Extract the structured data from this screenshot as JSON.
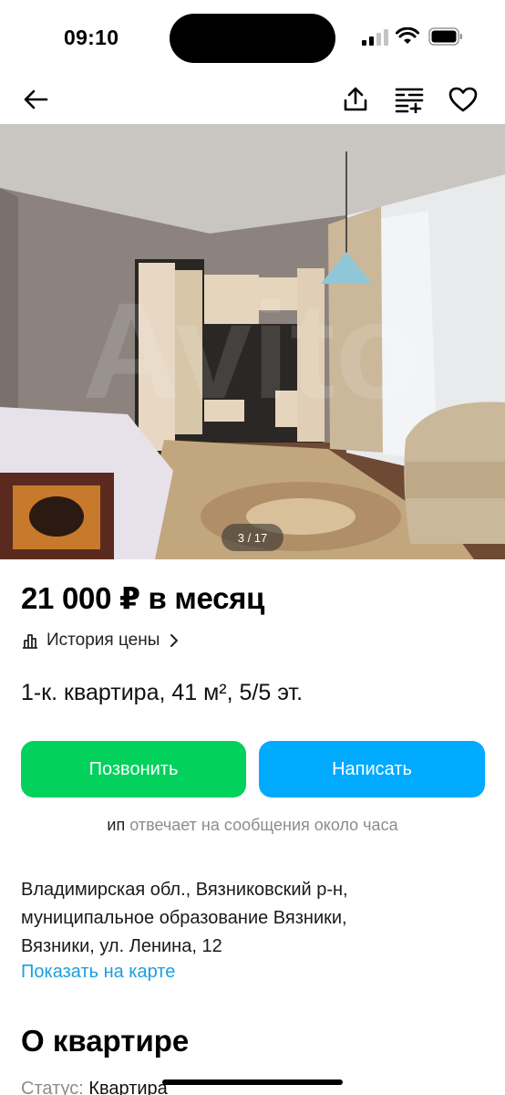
{
  "status_bar": {
    "time": "09:10"
  },
  "nav": {
    "back_icon": "arrow-left-icon",
    "share_icon": "share-icon",
    "compare_icon": "compare-list-icon",
    "favorite_icon": "heart-icon"
  },
  "gallery": {
    "counter": "3 / 17",
    "current": 3,
    "total": 17
  },
  "listing": {
    "price": "21 000 ₽ в месяц",
    "price_history": "История цены",
    "title": "1-к. квартира, 41 м², 5/5 эт."
  },
  "actions": {
    "call_label": "Позвонить",
    "write_label": "Написать",
    "call_color": "#02d15c",
    "write_color": "#00aaff"
  },
  "seller": {
    "name": "ип",
    "reply_time": "отвечает на сообщения около часа"
  },
  "location": {
    "address_line1": "Владимирская обл., Вязниковский р-н,",
    "address_line2": "муниципальное образование Вязники,",
    "address_line3": "Вязники, ул. Ленина, 12",
    "map_link": "Показать на карте"
  },
  "about": {
    "heading": "О квартире",
    "status_key": "Статус:",
    "status_value": "Квартира"
  }
}
